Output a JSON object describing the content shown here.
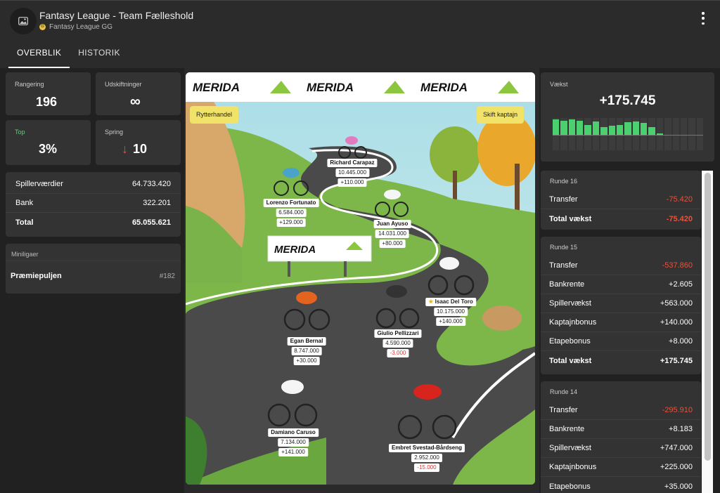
{
  "header": {
    "title": "Fantasy League - Team Fælleshold",
    "subtitle": "Fantasy League GG"
  },
  "tabs": [
    {
      "label": "OVERBLIK",
      "active": true
    },
    {
      "label": "HISTORIK",
      "active": false
    }
  ],
  "stats": {
    "rangering": {
      "label": "Rangering",
      "value": "196"
    },
    "udskiftninger": {
      "label": "Udskiftninger",
      "value": "∞"
    },
    "top": {
      "label": "Top",
      "value": "3%"
    },
    "spring": {
      "label": "Spring",
      "value": "10",
      "arrow": "↓"
    }
  },
  "finance": [
    {
      "label": "Spillerværdier",
      "value": "64.733.420"
    },
    {
      "label": "Bank",
      "value": "322.201"
    },
    {
      "label": "Total",
      "value": "65.055.621"
    }
  ],
  "minileagues": {
    "header": "Miniligaer",
    "items": [
      {
        "name": "Præmiepuljen",
        "rank": "#182"
      }
    ]
  },
  "scene": {
    "brand": "MERIDA",
    "trade_button": "Rytterhandel",
    "captain_button": "Skift kaptajn",
    "riders": [
      {
        "name": "Richard Carapaz",
        "value": "10.445.000",
        "change": "+110.000",
        "negative": false,
        "captain": false
      },
      {
        "name": "Lorenzo Fortunato",
        "value": "6.584.000",
        "change": "+129.000",
        "negative": false,
        "captain": false
      },
      {
        "name": "Juan Ayuso",
        "value": "14.031.000",
        "change": "+80.000",
        "negative": false,
        "captain": false
      },
      {
        "name": "Isaac Del Toro",
        "value": "10.175.000",
        "change": "+140.000",
        "negative": false,
        "captain": true
      },
      {
        "name": "Egan Bernal",
        "value": "8.747.000",
        "change": "+30.000",
        "negative": false,
        "captain": false
      },
      {
        "name": "Giulio Pellizzari",
        "value": "4.590.000",
        "change": "-3.000",
        "negative": true,
        "captain": false
      },
      {
        "name": "Damiano Caruso",
        "value": "7.134.000",
        "change": "+141.000",
        "negative": false,
        "captain": false
      },
      {
        "name": "Embret Svestad-Bårdseng",
        "value": "2.952.000",
        "change": "-15.000",
        "negative": true,
        "captain": false
      }
    ]
  },
  "growth": {
    "label": "Vækst",
    "value": "+175.745",
    "bars": [
      0.9,
      0.85,
      0.9,
      0.85,
      0.6,
      0.8,
      0.45,
      0.55,
      0.6,
      0.75,
      0.8,
      0.72,
      0.45,
      0.05,
      0,
      0,
      0,
      0,
      0
    ],
    "colors": {
      "positive": "#4ccf6e",
      "empty": "#3c3c3c"
    }
  },
  "rounds": [
    {
      "title": "Runde 16",
      "rows": [
        {
          "label": "Transfer",
          "value": "-75.420",
          "negative": true
        }
      ],
      "total": {
        "label": "Total vækst",
        "value": "-75.420",
        "negative": true
      }
    },
    {
      "title": "Runde 15",
      "rows": [
        {
          "label": "Transfer",
          "value": "-537.860",
          "negative": true
        },
        {
          "label": "Bankrente",
          "value": "+2.605",
          "negative": false
        },
        {
          "label": "Spillervækst",
          "value": "+563.000",
          "negative": false
        },
        {
          "label": "Kaptajnbonus",
          "value": "+140.000",
          "negative": false
        },
        {
          "label": "Etapebonus",
          "value": "+8.000",
          "negative": false
        }
      ],
      "total": {
        "label": "Total vækst",
        "value": "+175.745",
        "negative": false
      }
    },
    {
      "title": "Runde 14",
      "rows": [
        {
          "label": "Transfer",
          "value": "-295.910",
          "negative": true
        },
        {
          "label": "Bankrente",
          "value": "+8.183",
          "negative": false
        },
        {
          "label": "Spillervækst",
          "value": "+747.000",
          "negative": false
        },
        {
          "label": "Kaptajnbonus",
          "value": "+225.000",
          "negative": false
        },
        {
          "label": "Etapebonus",
          "value": "+35.000",
          "negative": false
        }
      ]
    }
  ]
}
